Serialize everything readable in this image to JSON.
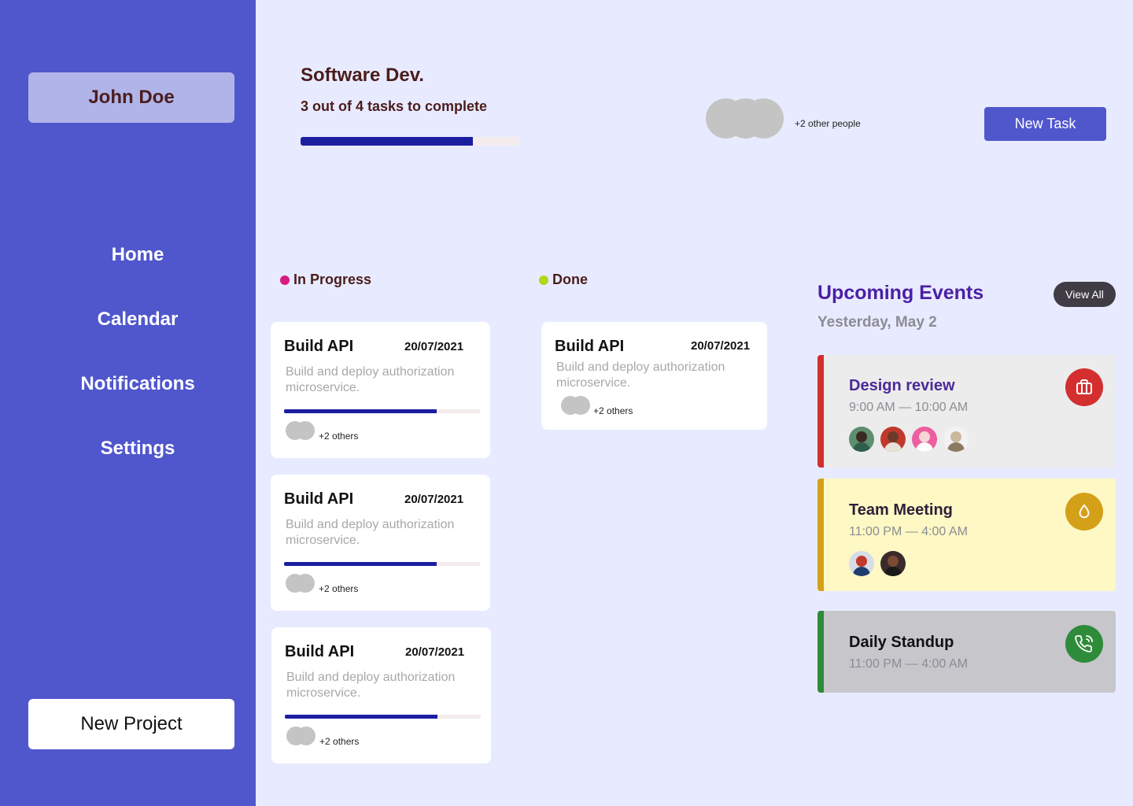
{
  "user": {
    "name": "John Doe"
  },
  "nav": [
    {
      "label": "Home"
    },
    {
      "label": "Calendar"
    },
    {
      "label": "Notifications"
    },
    {
      "label": "Settings"
    }
  ],
  "sidebar_action": "New Project",
  "project": {
    "title": "Software Dev.",
    "subtitle": "3 out of 4 tasks to complete",
    "progress": 0.79,
    "other_people": "+2 other people",
    "new_task_label": "New Task"
  },
  "columns": {
    "in_progress": {
      "label": "In Progress",
      "dot_color": "#d81b7f",
      "cards": [
        {
          "title": "Build API",
          "date": "20/07/2021",
          "desc": "Build and deploy authorization microservice.",
          "progress": 0.78,
          "others": "+2 others"
        },
        {
          "title": "Build API",
          "date": "20/07/2021",
          "desc": "Build and deploy authorization microservice.",
          "progress": 0.78,
          "others": "+2 others"
        },
        {
          "title": "Build API",
          "date": "20/07/2021",
          "desc": "Build and deploy authorization microservice.",
          "progress": 0.78,
          "others": "+2 others"
        }
      ]
    },
    "done": {
      "label": "Done",
      "dot_color": "#b2d61a",
      "cards": [
        {
          "title": "Build API",
          "date": "20/07/2021",
          "desc": "Build and deploy authorization microservice.",
          "others": "+2 others"
        }
      ]
    }
  },
  "events": {
    "title": "Upcoming Events",
    "view_all": "View All",
    "date": "Yesterday, May 2",
    "items": [
      {
        "name": "Design review",
        "time": "9:00 AM — 10:00 AM",
        "icon": "briefcase-icon",
        "stripe_color": "#d32f2f",
        "bg_color": "#ececec",
        "icon_color": "#d32f2f",
        "name_color": "#4b2a9a"
      },
      {
        "name": "Team Meeting",
        "time": "11:00 PM — 4:00 AM",
        "icon": "drop-icon",
        "stripe_color": "#d4a017",
        "bg_color": "#fdf8c4",
        "icon_color": "#d4a017",
        "name_color": "#2e1f3a"
      },
      {
        "name": "Daily Standup",
        "time": "11:00 PM — 4:00 AM",
        "icon": "phone-icon",
        "stripe_color": "#2e8b3a",
        "bg_color": "#c6c6cb",
        "icon_color": "#2e8b3a",
        "name_color": "#111111"
      }
    ]
  }
}
